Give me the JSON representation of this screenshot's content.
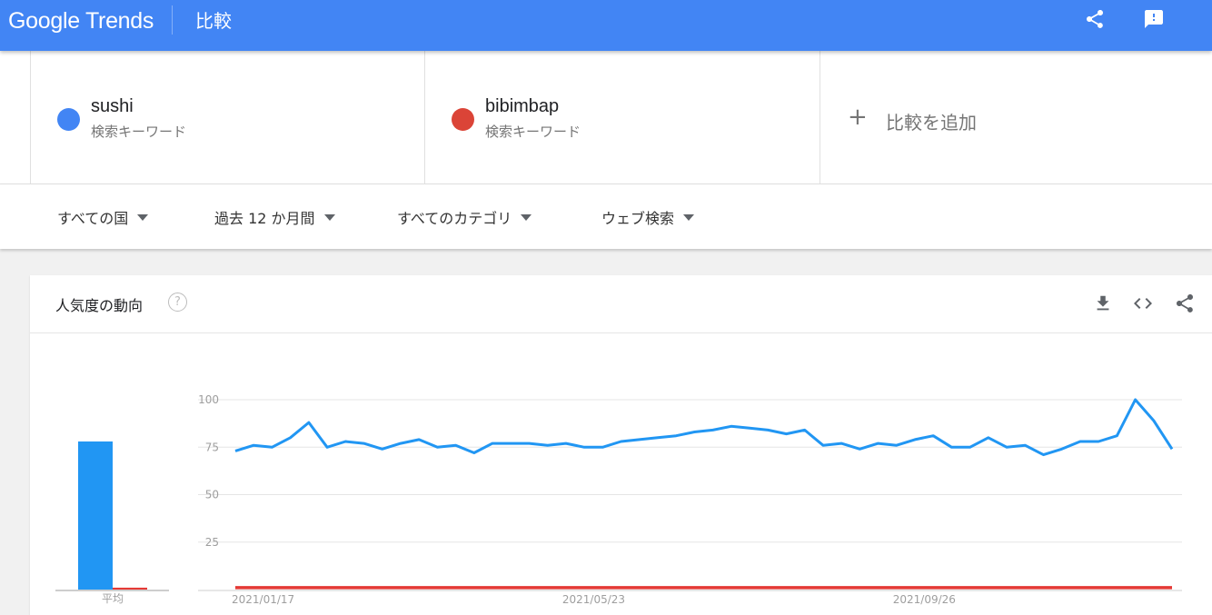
{
  "header": {
    "logo": "Google Trends",
    "page_title": "比較",
    "share_icon": "share-icon",
    "feedback_icon": "feedback-icon",
    "color": "#4285f4"
  },
  "terms": [
    {
      "name": "sushi",
      "type": "検索キーワード",
      "color": "#4285f4"
    },
    {
      "name": "bibimbap",
      "type": "検索キーワード",
      "color": "#db4437"
    }
  ],
  "add_compare": {
    "plus": "+",
    "label": "比較を追加"
  },
  "filters": [
    {
      "label": "すべての国"
    },
    {
      "label": "過去 12 か月間"
    },
    {
      "label": "すべてのカテゴリ"
    },
    {
      "label": "ウェブ検索"
    }
  ],
  "card": {
    "title": "人気度の動向",
    "help": "?",
    "icons": [
      "download-icon",
      "embed-code-icon",
      "share-icon"
    ]
  },
  "chart_data": {
    "type": "line",
    "title": "",
    "y_ticks": [
      "100",
      "75",
      "50",
      "25"
    ],
    "ylim": [
      0,
      100
    ],
    "x_tick_labels": [
      {
        "label": "2021/01/17",
        "index": 0
      },
      {
        "label": "2021/05/23",
        "index": 18
      },
      {
        "label": "2021/09/26",
        "index": 36
      }
    ],
    "average_label": "平均",
    "averages": {
      "sushi": 78,
      "bibimbap": 1
    },
    "grid": true,
    "series": [
      {
        "name": "sushi",
        "color": "#2196f3",
        "values": [
          73,
          76,
          75,
          80,
          88,
          75,
          78,
          77,
          74,
          77,
          79,
          75,
          76,
          72,
          77,
          77,
          77,
          76,
          77,
          75,
          75,
          78,
          79,
          80,
          81,
          83,
          84,
          86,
          85,
          84,
          82,
          84,
          76,
          77,
          74,
          77,
          76,
          79,
          81,
          75,
          75,
          80,
          75,
          76,
          71,
          74,
          78,
          78,
          81,
          100,
          89,
          74
        ]
      },
      {
        "name": "bibimbap",
        "color": "#e53935",
        "values": [
          1,
          1,
          1,
          1,
          1,
          1,
          1,
          1,
          1,
          1,
          1,
          1,
          1,
          1,
          1,
          1,
          1,
          1,
          1,
          1,
          1,
          1,
          1,
          1,
          1,
          1,
          1,
          1,
          1,
          1,
          1,
          1,
          1,
          1,
          1,
          1,
          1,
          1,
          1,
          1,
          1,
          1,
          1,
          1,
          1,
          1,
          1,
          1,
          1,
          1,
          1,
          1
        ]
      }
    ]
  }
}
